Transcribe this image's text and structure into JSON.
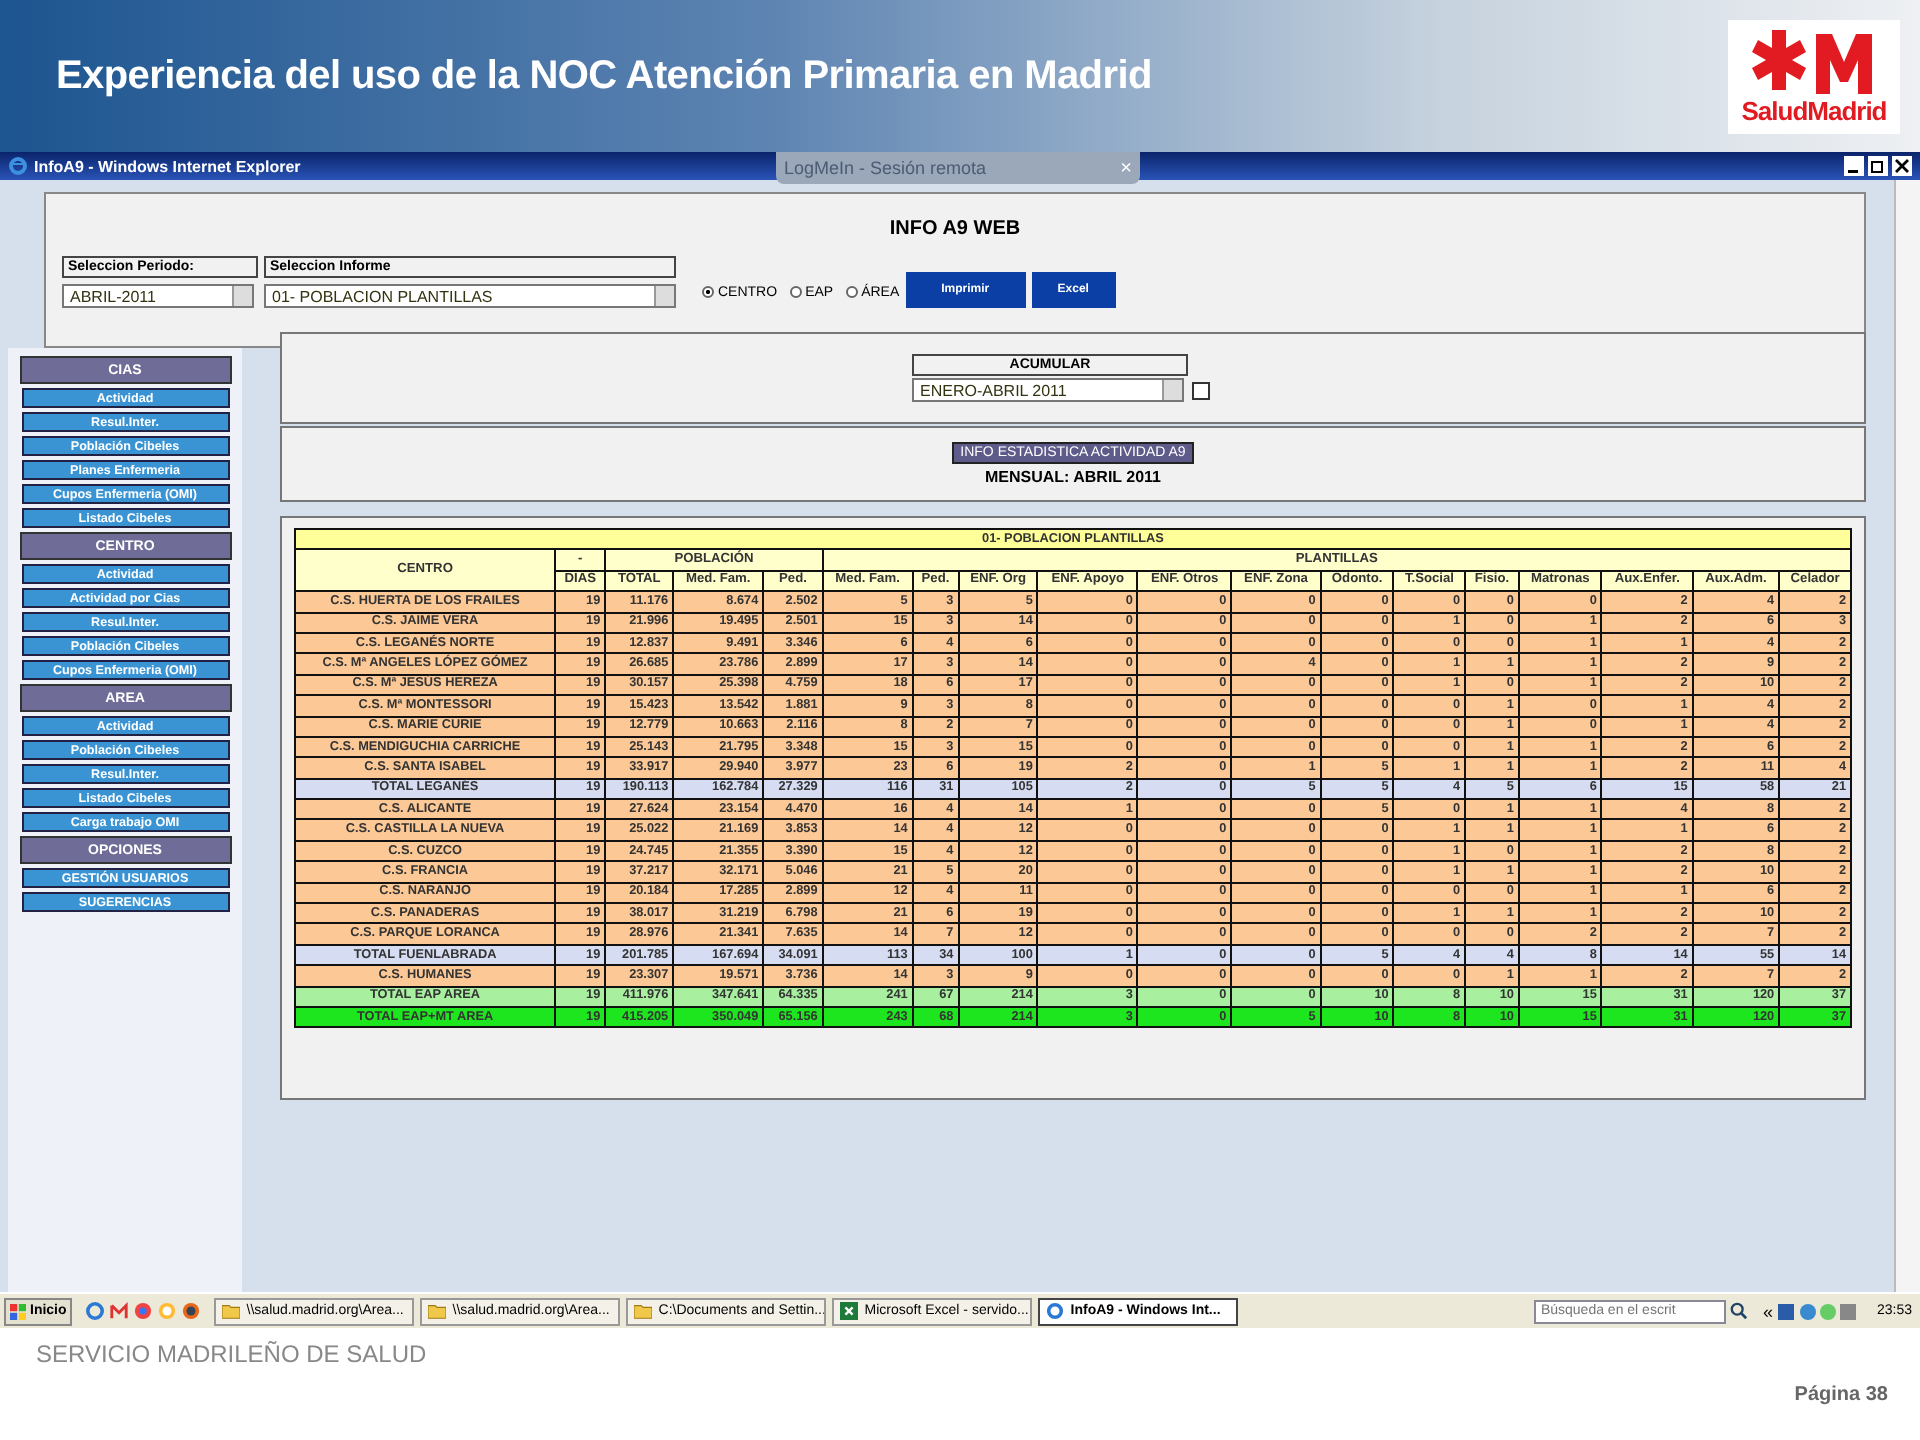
{
  "slide": {
    "title": "Experiencia del uso de la NOC Atención Primaria en Madrid",
    "logo_text": "SaludMadrid",
    "footer": "SERVICIO MADRILEÑO DE SALUD",
    "page": "Página 38"
  },
  "window": {
    "title": "InfoA9 - Windows Internet Explorer",
    "remote_tab": "LogMeIn - Sesión remota",
    "remote_close": "×"
  },
  "app": {
    "heading": "INFO A9 WEB",
    "period": {
      "label": "Seleccion Periodo:",
      "value": "ABRIL-2011"
    },
    "report": {
      "label": "Seleccion Informe",
      "value": "01- POBLACION PLANTILLAS"
    },
    "scopes": [
      {
        "label": "CENTRO",
        "selected": true
      },
      {
        "label": "EAP",
        "selected": false
      },
      {
        "label": "ÁREA",
        "selected": false
      }
    ],
    "buttons": [
      "Imprimir",
      "Excel"
    ],
    "accumulate": {
      "label": "ACUMULAR",
      "value": "ENERO-ABRIL 2011",
      "checked": false
    },
    "stats_badge": "INFO ESTADISTICA ACTIVIDAD A9",
    "stats_period": "MENSUAL: ABRIL 2011"
  },
  "sidebar": [
    {
      "title": "CIAS",
      "items": [
        "Actividad",
        "Resul.Inter.",
        "Población Cibeles",
        "Planes Enfermeria",
        "Cupos Enfermeria (OMI)",
        "Listado Cibeles"
      ]
    },
    {
      "title": "CENTRO",
      "items": [
        "Actividad",
        "Actividad por Cias",
        "Resul.Inter.",
        "Población Cibeles",
        "Cupos Enfermeria (OMI)"
      ]
    },
    {
      "title": "AREA",
      "items": [
        "Actividad",
        "Población Cibeles",
        "Resul.Inter.",
        "Listado Cibeles",
        "Carga trabajo OMI"
      ]
    },
    {
      "title": "OPCIONES",
      "items": [
        "GESTIÓN USUARIOS",
        "SUGERENCIAS"
      ]
    }
  ],
  "table": {
    "title": "01- POBLACION PLANTILLAS",
    "groups": [
      "-",
      "POBLACIÓN",
      "PLANTILLAS"
    ],
    "columns": [
      "CENTRO",
      "DIAS",
      "TOTAL",
      "Med. Fam.",
      "Ped.",
      "Med. Fam.",
      "Ped.",
      "ENF. Org",
      "ENF. Apoyo",
      "ENF. Otros",
      "ENF. Zona",
      "Odonto.",
      "T.Social",
      "Fisio.",
      "Matronas",
      "Aux.Enfer.",
      "Aux.Adm.",
      "Celador"
    ],
    "rows": [
      {
        "kind": "center",
        "cells": [
          "C.S. HUERTA DE LOS FRAILES",
          "19",
          "11.176",
          "8.674",
          "2.502",
          "5",
          "3",
          "5",
          "0",
          "0",
          "0",
          "0",
          "0",
          "0",
          "0",
          "2",
          "4",
          "2"
        ]
      },
      {
        "kind": "center",
        "cells": [
          "C.S. JAIME VERA",
          "19",
          "21.996",
          "19.495",
          "2.501",
          "15",
          "3",
          "14",
          "0",
          "0",
          "0",
          "0",
          "1",
          "0",
          "1",
          "2",
          "6",
          "3"
        ]
      },
      {
        "kind": "center",
        "cells": [
          "C.S. LEGANÉS NORTE",
          "19",
          "12.837",
          "9.491",
          "3.346",
          "6",
          "4",
          "6",
          "0",
          "0",
          "0",
          "0",
          "0",
          "0",
          "1",
          "1",
          "4",
          "2"
        ]
      },
      {
        "kind": "center",
        "cells": [
          "C.S. Mª ANGELES LÓPEZ GÓMEZ",
          "19",
          "26.685",
          "23.786",
          "2.899",
          "17",
          "3",
          "14",
          "0",
          "0",
          "4",
          "0",
          "1",
          "1",
          "1",
          "2",
          "9",
          "2"
        ]
      },
      {
        "kind": "center",
        "cells": [
          "C.S. Mª JESÚS HEREZA",
          "19",
          "30.157",
          "25.398",
          "4.759",
          "18",
          "6",
          "17",
          "0",
          "0",
          "0",
          "0",
          "1",
          "0",
          "1",
          "2",
          "10",
          "2"
        ]
      },
      {
        "kind": "center",
        "cells": [
          "C.S. Mª MONTESSORI",
          "19",
          "15.423",
          "13.542",
          "1.881",
          "9",
          "3",
          "8",
          "0",
          "0",
          "0",
          "0",
          "0",
          "1",
          "0",
          "1",
          "4",
          "2"
        ]
      },
      {
        "kind": "center",
        "cells": [
          "C.S. MARIE CURIE",
          "19",
          "12.779",
          "10.663",
          "2.116",
          "8",
          "2",
          "7",
          "0",
          "0",
          "0",
          "0",
          "0",
          "1",
          "0",
          "1",
          "4",
          "2"
        ]
      },
      {
        "kind": "center",
        "cells": [
          "C.S. MENDIGUCHIA CARRICHE",
          "19",
          "25.143",
          "21.795",
          "3.348",
          "15",
          "3",
          "15",
          "0",
          "0",
          "0",
          "0",
          "0",
          "1",
          "1",
          "2",
          "6",
          "2"
        ]
      },
      {
        "kind": "center",
        "cells": [
          "C.S. SANTA ISABEL",
          "19",
          "33.917",
          "29.940",
          "3.977",
          "23",
          "6",
          "19",
          "2",
          "0",
          "1",
          "5",
          "1",
          "1",
          "1",
          "2",
          "11",
          "4"
        ]
      },
      {
        "kind": "total",
        "cells": [
          "TOTAL LEGANÉS",
          "19",
          "190.113",
          "162.784",
          "27.329",
          "116",
          "31",
          "105",
          "2",
          "0",
          "5",
          "5",
          "4",
          "5",
          "6",
          "15",
          "58",
          "21"
        ]
      },
      {
        "kind": "center",
        "cells": [
          "C.S. ALICANTE",
          "19",
          "27.624",
          "23.154",
          "4.470",
          "16",
          "4",
          "14",
          "1",
          "0",
          "0",
          "5",
          "0",
          "1",
          "1",
          "4",
          "8",
          "2"
        ]
      },
      {
        "kind": "center",
        "cells": [
          "C.S. CASTILLA LA NUEVA",
          "19",
          "25.022",
          "21.169",
          "3.853",
          "14",
          "4",
          "12",
          "0",
          "0",
          "0",
          "0",
          "1",
          "1",
          "1",
          "1",
          "6",
          "2"
        ]
      },
      {
        "kind": "center",
        "cells": [
          "C.S. CUZCO",
          "19",
          "24.745",
          "21.355",
          "3.390",
          "15",
          "4",
          "12",
          "0",
          "0",
          "0",
          "0",
          "1",
          "0",
          "1",
          "2",
          "8",
          "2"
        ]
      },
      {
        "kind": "center",
        "cells": [
          "C.S. FRANCIA",
          "19",
          "37.217",
          "32.171",
          "5.046",
          "21",
          "5",
          "20",
          "0",
          "0",
          "0",
          "0",
          "1",
          "1",
          "1",
          "2",
          "10",
          "2"
        ]
      },
      {
        "kind": "center",
        "cells": [
          "C.S. NARANJO",
          "19",
          "20.184",
          "17.285",
          "2.899",
          "12",
          "4",
          "11",
          "0",
          "0",
          "0",
          "0",
          "0",
          "0",
          "1",
          "1",
          "6",
          "2"
        ]
      },
      {
        "kind": "center",
        "cells": [
          "C.S. PANADERAS",
          "19",
          "38.017",
          "31.219",
          "6.798",
          "21",
          "6",
          "19",
          "0",
          "0",
          "0",
          "0",
          "1",
          "1",
          "1",
          "2",
          "10",
          "2"
        ]
      },
      {
        "kind": "center",
        "cells": [
          "C.S. PARQUE LORANCA",
          "19",
          "28.976",
          "21.341",
          "7.635",
          "14",
          "7",
          "12",
          "0",
          "0",
          "0",
          "0",
          "0",
          "0",
          "2",
          "2",
          "7",
          "2"
        ]
      },
      {
        "kind": "total",
        "cells": [
          "TOTAL FUENLABRADA",
          "19",
          "201.785",
          "167.694",
          "34.091",
          "113",
          "34",
          "100",
          "1",
          "0",
          "0",
          "5",
          "4",
          "4",
          "8",
          "14",
          "55",
          "14"
        ]
      },
      {
        "kind": "center",
        "cells": [
          "C.S. HUMANES",
          "19",
          "23.307",
          "19.571",
          "3.736",
          "14",
          "3",
          "9",
          "0",
          "0",
          "0",
          "0",
          "0",
          "1",
          "1",
          "2",
          "7",
          "2"
        ]
      },
      {
        "kind": "area_total",
        "cells": [
          "TOTAL EAP AREA",
          "19",
          "411.976",
          "347.641",
          "64.335",
          "241",
          "67",
          "214",
          "3",
          "0",
          "0",
          "10",
          "8",
          "10",
          "15",
          "31",
          "120",
          "37"
        ]
      },
      {
        "kind": "grand_total",
        "cells": [
          "TOTAL EAP+MT AREA",
          "19",
          "415.205",
          "350.049",
          "65.156",
          "243",
          "68",
          "214",
          "3",
          "0",
          "5",
          "10",
          "8",
          "10",
          "15",
          "31",
          "120",
          "37"
        ]
      }
    ]
  },
  "taskbar": {
    "start": "Inicio",
    "tasks": [
      {
        "label": "\\\\salud.madrid.org\\Area...",
        "kind": "folder",
        "selected": false
      },
      {
        "label": "\\\\salud.madrid.org\\Area...",
        "kind": "folder",
        "selected": false
      },
      {
        "label": "C:\\Documents and Settin...",
        "kind": "folder",
        "selected": false
      },
      {
        "label": "Microsoft Excel - servido...",
        "kind": "excel",
        "selected": false
      },
      {
        "label": "InfoA9 - Windows Int...",
        "kind": "browser",
        "selected": true
      }
    ],
    "search": {
      "placeholder": "Búsqueda en el escrit"
    },
    "chevron": "«",
    "time": "23:53"
  }
}
